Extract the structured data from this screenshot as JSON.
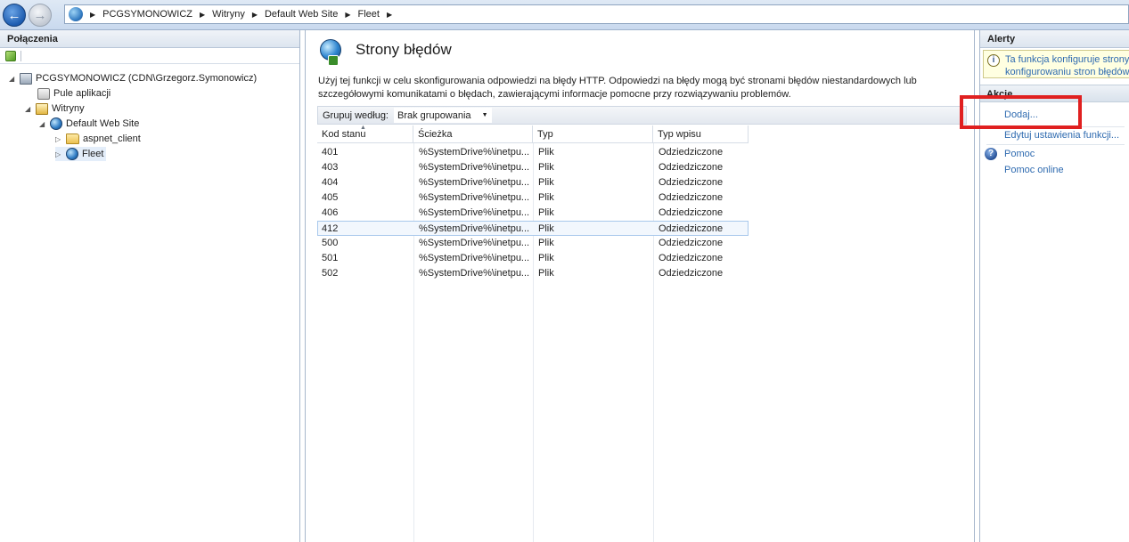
{
  "address_bar": {
    "crumbs": [
      "PCGSYMONOWICZ",
      "Witryny",
      "Default Web Site",
      "Fleet"
    ]
  },
  "connections": {
    "title": "Połączenia",
    "tree": [
      {
        "label": "PCGSYMONOWICZ (CDN\\Grzegorz.Symonowicz)",
        "icon": "server-icon",
        "twisty": "expanded"
      },
      {
        "label": "Pule aplikacji",
        "icon": "app-pool-icon",
        "twisty": "none"
      },
      {
        "label": "Witryny",
        "icon": "sites-folder-icon",
        "twisty": "expanded"
      },
      {
        "label": "Default Web Site",
        "icon": "globe-icon",
        "twisty": "expanded"
      },
      {
        "label": "aspnet_client",
        "icon": "folder-icon",
        "twisty": "collapsed"
      },
      {
        "label": "Fleet",
        "icon": "web-app-icon",
        "twisty": "collapsed",
        "selected": true
      }
    ]
  },
  "main": {
    "title": "Strony błędów",
    "description_line1": "Użyj tej funkcji w celu skonfigurowania odpowiedzi na błędy HTTP. Odpowiedzi na błędy mogą być stronami błędów niestandardowych lub",
    "description_line2": "szczegółowymi komunikatami o błędach, zawierającymi informacje pomocne przy rozwiązywaniu problemów.",
    "group_by_label": "Grupuj według:",
    "group_by_value": "Brak grupowania",
    "columns": [
      "Kod stanu",
      "Ścieżka",
      "Typ",
      "Typ wpisu"
    ],
    "rows": [
      {
        "code": "401",
        "path": "%SystemDrive%\\inetpu...",
        "type": "Plik",
        "entry_type": "Odziedziczone"
      },
      {
        "code": "403",
        "path": "%SystemDrive%\\inetpu...",
        "type": "Plik",
        "entry_type": "Odziedziczone"
      },
      {
        "code": "404",
        "path": "%SystemDrive%\\inetpu...",
        "type": "Plik",
        "entry_type": "Odziedziczone"
      },
      {
        "code": "405",
        "path": "%SystemDrive%\\inetpu...",
        "type": "Plik",
        "entry_type": "Odziedziczone"
      },
      {
        "code": "406",
        "path": "%SystemDrive%\\inetpu...",
        "type": "Plik",
        "entry_type": "Odziedziczone"
      },
      {
        "code": "412",
        "path": "%SystemDrive%\\inetpu...",
        "type": "Plik",
        "entry_type": "Odziedziczone",
        "selected": true
      },
      {
        "code": "500",
        "path": "%SystemDrive%\\inetpu...",
        "type": "Plik",
        "entry_type": "Odziedziczone"
      },
      {
        "code": "501",
        "path": "%SystemDrive%\\inetpu...",
        "type": "Plik",
        "entry_type": "Odziedziczone"
      },
      {
        "code": "502",
        "path": "%SystemDrive%\\inetpu...",
        "type": "Plik",
        "entry_type": "Odziedziczone"
      }
    ]
  },
  "right_panel": {
    "alerts_title": "Alerty",
    "alert_line1": "Ta funkcja konfiguruje strony",
    "alert_line2": "konfigurowaniu stron błędów",
    "actions_title": "Akcje",
    "action_add": "Dodaj...",
    "action_edit": "Edytuj ustawienia funkcji...",
    "help": "Pomoc",
    "help_online": "Pomoc online"
  },
  "colors": {
    "highlight": "#e02020",
    "link": "#2f6bb0"
  }
}
